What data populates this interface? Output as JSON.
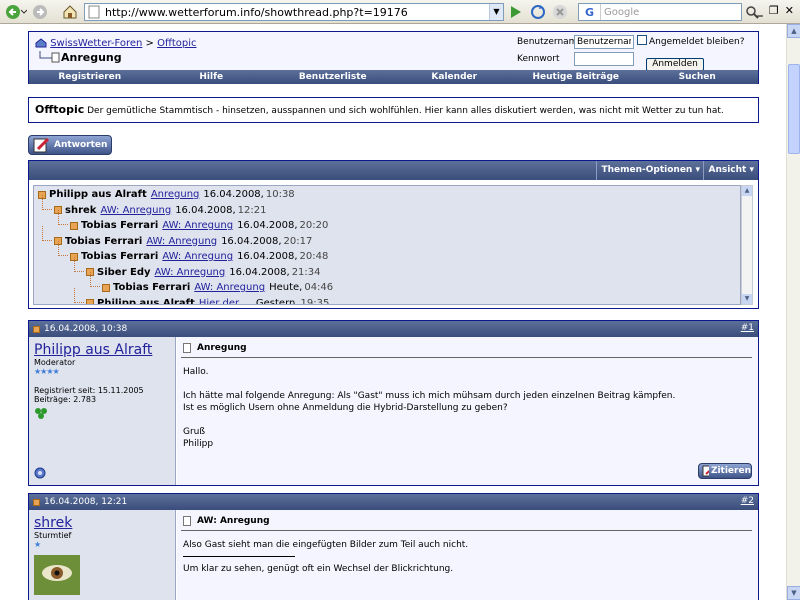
{
  "browser": {
    "url": "http://www.wetterforum.info/showthread.php?t=19176",
    "search_engine": "G",
    "search_placeholder": "Google"
  },
  "breadcrumb": {
    "root": "SwissWetter-Foren",
    "separator": ">",
    "forum": "Offtopic",
    "thread_title": "Anregung"
  },
  "login": {
    "username_label": "Benutzername",
    "username_value": "Benutzername",
    "remember_label": "Angemeldet bleiben?",
    "password_label": "Kennwort",
    "submit_label": "Anmelden"
  },
  "navbar": [
    "Registrieren",
    "Hilfe",
    "Benutzerliste",
    "Kalender",
    "Heutige Beiträge",
    "Suchen"
  ],
  "forum_desc": {
    "name": "Offtopic",
    "text": "Der gemütliche Stammtisch - hinsetzen, ausspannen und sich wohlfühlen. Hier kann alles diskutiert werden, was nicht mit Wetter zu tun hat."
  },
  "reply_button": "Antworten",
  "thread_tools": {
    "options": "Themen-Optionen",
    "view": "Ansicht"
  },
  "tree": [
    {
      "author": "Philipp aus Alraft",
      "title": "Anregung",
      "date": "16.04.2008,",
      "time": "10:38",
      "depth": 0
    },
    {
      "author": "shrek",
      "title": "AW: Anregung",
      "date": "16.04.2008,",
      "time": "12:21",
      "depth": 1
    },
    {
      "author": "Tobias Ferrari",
      "title": "AW: Anregung",
      "date": "16.04.2008,",
      "time": "20:20",
      "depth": 2
    },
    {
      "author": "Tobias Ferrari",
      "title": "AW: Anregung",
      "date": "16.04.2008,",
      "time": "20:17",
      "depth": 1
    },
    {
      "author": "Tobias Ferrari",
      "title": "AW: Anregung",
      "date": "16.04.2008,",
      "time": "20:48",
      "depth": 2
    },
    {
      "author": "Siber Edy",
      "title": "AW: Anregung",
      "date": "16.04.2008,",
      "time": "21:34",
      "depth": 3
    },
    {
      "author": "Tobias Ferrari",
      "title": "AW: Anregung",
      "date": "Heute,",
      "time": "04:46",
      "depth": 4
    },
    {
      "author": "Philipp aus Alraft",
      "title": "Hier der ...",
      "date": "Gestern,",
      "time": "19:35",
      "depth": 3
    }
  ],
  "posts": [
    {
      "datetime": "16.04.2008, 10:38",
      "number": "#1",
      "author": "Philipp aus Alraft",
      "rank": "Moderator",
      "stars": "★★★★",
      "registered": "Registriert seit: 15.11.2005",
      "posts_count": "Beiträge: 2.783",
      "title": "Anregung",
      "body": [
        "Hallo.",
        "",
        "Ich hätte mal folgende Anregung: Als \"Gast\" muss ich mich mühsam durch jeden einzelnen Beitrag kämpfen.",
        "Ist es möglich Usern ohne Anmeldung die Hybrid-Darstellung zu geben?",
        "",
        "Gruß",
        "Philipp"
      ],
      "quote_button": "Zitieren"
    },
    {
      "datetime": "16.04.2008, 12:21",
      "number": "#2",
      "author": "shrek",
      "rank": "Sturmtief",
      "stars": "★",
      "title": "AW: Anregung",
      "body": [
        "Also Gast sieht man die eingefügten Bilder zum Teil auch nicht.",
        "",
        "Um klar zu sehen, genügt oft ein Wechsel der Blickrichtung."
      ]
    }
  ]
}
